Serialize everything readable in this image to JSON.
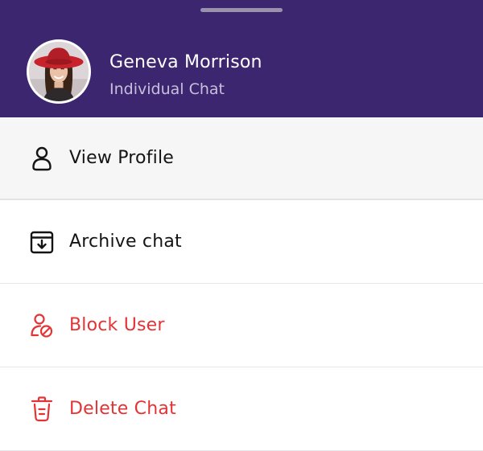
{
  "contact": {
    "name": "Geneva Morrison",
    "subtitle": "Individual Chat"
  },
  "menu": {
    "items": [
      {
        "label": "View Profile",
        "icon": "user-icon",
        "color": "#141414",
        "selected": true
      },
      {
        "label": "Archive chat",
        "icon": "archive-icon",
        "color": "#141414"
      },
      {
        "label": "Block User",
        "icon": "block-user-icon",
        "color": "#e53235"
      },
      {
        "label": "Delete Chat",
        "icon": "trash-icon",
        "color": "#e53235"
      }
    ]
  },
  "colors": {
    "header_bg": "#3d2670",
    "danger": "#e53235",
    "text": "#141414",
    "subtitle": "#c8bfdc"
  }
}
